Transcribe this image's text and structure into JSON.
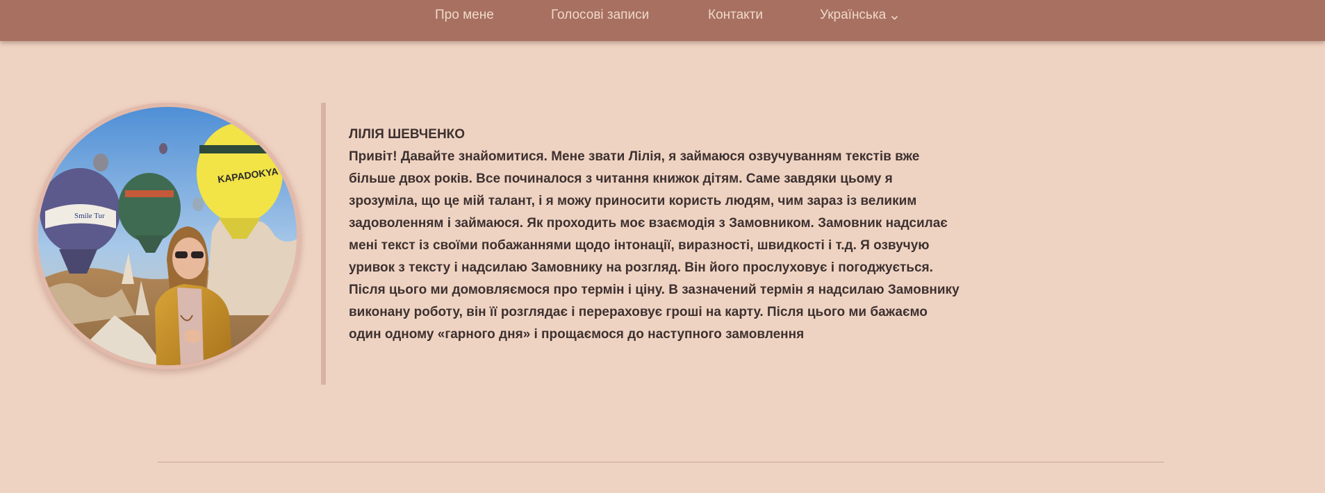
{
  "nav": {
    "items": [
      {
        "label": "Про мене"
      },
      {
        "label": "Голосові записи"
      },
      {
        "label": "Контакти"
      }
    ],
    "language": "Українська"
  },
  "profile": {
    "name": "ЛІЛІЯ ШЕВЧЕНКО",
    "bio": "Привіт! Давайте знайомитися. Мене звати Лілія, я займаюся озвучуванням текстів вже більше двох років. Все починалося з читання книжок дітям. Саме завдяки цьому я зрозуміла, що це мій талант, і я можу приносити користь людям, чим зараз із великим задоволенням і займаюся. Як проходить моє взаємодія з Замовником. Замовник надсилає мені текст із своїми побажаннями щодо інтонації, виразності, швидкості і т.д. Я озвучую уривок з тексту і надсилаю Замовнику на розгляд. Він його прослуховує і погоджується. Після цього ми домовляємося про термін і ціну. В зазначений термін я надсилаю Замовнику виконану роботу, він її розглядає і перераховує гроші на карту. Після цього ми бажаємо один одному «гарного дня» і прощаємося до наступного замовлення",
    "photo": {
      "balloon_texts": [
        "Smile Tur",
        "KAPADOKYA"
      ]
    }
  },
  "colors": {
    "background": "#efd3c2",
    "navbar": "#a77060",
    "nav_text": "#f1d9ca",
    "body_text": "#3d3130",
    "accent_bar": "#d8b2a4"
  }
}
